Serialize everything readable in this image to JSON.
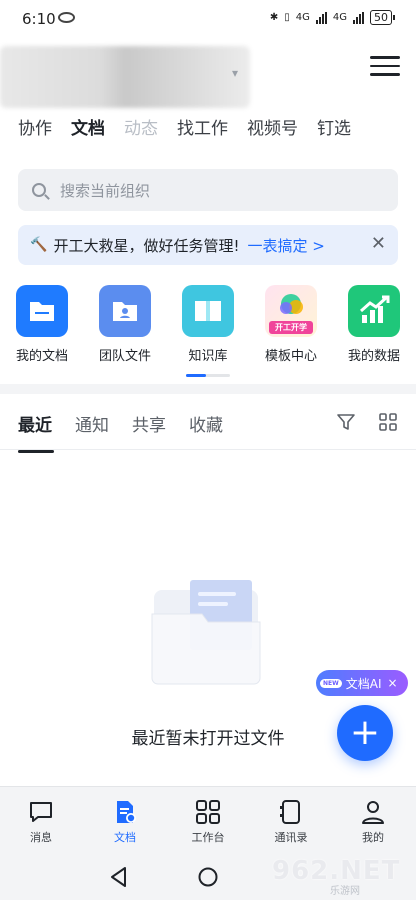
{
  "status": {
    "time": "6:10",
    "network": "4G",
    "battery": "50"
  },
  "header": {
    "tabs": [
      {
        "label": "协作",
        "state": "normal"
      },
      {
        "label": "文档",
        "state": "active"
      },
      {
        "label": "动态",
        "state": "faded"
      },
      {
        "label": "找工作",
        "state": "normal"
      },
      {
        "label": "视频号",
        "state": "normal"
      },
      {
        "label": "钉选",
        "state": "normal"
      }
    ]
  },
  "search": {
    "placeholder": "搜索当前组织"
  },
  "banner": {
    "text": "开工大救星，做好任务管理!",
    "link": "一表搞定 >"
  },
  "shortcuts": [
    {
      "label": "我的文档",
      "icon": "folder-icon",
      "color": "#1f7bff"
    },
    {
      "label": "团队文件",
      "icon": "team-folder-icon",
      "color": "#5b8def"
    },
    {
      "label": "知识库",
      "icon": "book-icon",
      "color": "#3fc6e0"
    },
    {
      "label": "模板中心",
      "icon": "template-icon",
      "badge": "开工开学",
      "color": "#f0449a"
    },
    {
      "label": "我的数据",
      "icon": "chart-icon",
      "color": "#1fc77a"
    }
  ],
  "pager": {
    "pages": 2,
    "current": 1
  },
  "content": {
    "tabs": [
      "最近",
      "通知",
      "共享",
      "收藏"
    ],
    "active_tab": 0,
    "empty_text": "最近暂未打开过文件"
  },
  "ai": {
    "badge": "NEW",
    "label": "文档AI",
    "close": "×"
  },
  "fab": {
    "symbol": "+"
  },
  "bottom_nav": [
    {
      "label": "消息",
      "icon": "message-icon"
    },
    {
      "label": "文档",
      "icon": "doc-icon",
      "active": true
    },
    {
      "label": "工作台",
      "icon": "workbench-icon"
    },
    {
      "label": "通讯录",
      "icon": "contacts-icon"
    },
    {
      "label": "我的",
      "icon": "profile-icon"
    }
  ],
  "watermark": {
    "text": "962.NET",
    "sub": "乐游网"
  }
}
